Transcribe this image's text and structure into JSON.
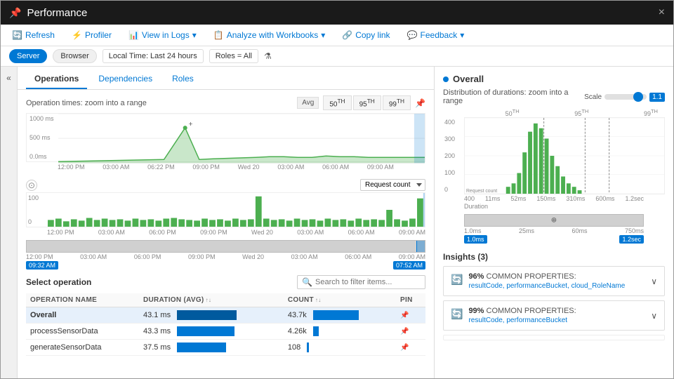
{
  "window": {
    "title": "Performance",
    "close_label": "×",
    "pin_label": "📌"
  },
  "toolbar": {
    "refresh_label": "Refresh",
    "profiler_label": "Profiler",
    "view_in_logs_label": "View in Logs",
    "analyze_label": "Analyze with Workbooks",
    "copy_link_label": "Copy link",
    "feedback_label": "Feedback"
  },
  "filter_bar": {
    "server_label": "Server",
    "browser_label": "Browser",
    "time_label": "Local Time: Last 24 hours",
    "roles_label": "Roles = All"
  },
  "tabs": {
    "operations": "Operations",
    "dependencies": "Dependencies",
    "roles": "Roles"
  },
  "chart": {
    "title": "Operation times: zoom into a range",
    "avg_label": "Avg",
    "p50_label": "50",
    "p50_sup": "TH",
    "p95_label": "95",
    "p95_sup": "TH",
    "p99_label": "99",
    "p99_sup": "TH",
    "y_labels": [
      "1000 ms",
      "500 ms",
      "0.0ms"
    ],
    "x_labels": [
      "12:00 PM",
      "03:00 AM",
      "06:22 PM",
      "09:00 PM",
      "Wed 20",
      "03:00 AM",
      "06:00 AM",
      "09:00 AM"
    ]
  },
  "request_chart": {
    "dropdown_label": "Request count",
    "y_labels": [
      "100",
      "0"
    ],
    "x_labels": [
      "12:00 PM",
      "03:00 AM",
      "06:00 PM",
      "09:00 PM",
      "Wed 20",
      "03:00 AM",
      "06:00 AM",
      "09:00 AM"
    ]
  },
  "timeline": {
    "x_labels": [
      "12:00 PM",
      "03:00 AM",
      "06:00 PM",
      "09:00 PM",
      "Wed 20",
      "03:00 AM",
      "06:00 AM",
      "09:00 AM"
    ],
    "start_time": "09:32 AM",
    "end_time": "07:52 AM"
  },
  "operations": {
    "title": "Select operation",
    "search_placeholder": "Search to filter items...",
    "columns": {
      "name": "OPERATION NAME",
      "duration": "DURATION (AVG)",
      "count": "COUNT",
      "pin": "PIN"
    },
    "rows": [
      {
        "name": "Overall",
        "duration": "43.1 ms",
        "duration_pct": 85,
        "count": "43.7k",
        "count_pct": 100,
        "selected": true
      },
      {
        "name": "processSensorData",
        "duration": "43.3 ms",
        "duration_pct": 82,
        "count": "4.26k",
        "count_pct": 10,
        "selected": false
      },
      {
        "name": "generateSensorData",
        "duration": "37.5 ms",
        "duration_pct": 70,
        "count": "108",
        "count_pct": 3,
        "selected": false
      }
    ]
  },
  "right": {
    "overall_title": "Overall",
    "dist_title": "Distribution of durations: zoom into a range",
    "scale_label": "Scale",
    "percentile_labels": [
      "50TH",
      "95TH",
      "99TH"
    ],
    "dist_x_labels": [
      "400",
      "11ms",
      "52ms",
      "150ms",
      "310ms",
      "600ms",
      "1.2sec"
    ],
    "dist_y_labels": [
      "300",
      "200",
      "100",
      "0"
    ],
    "dist_timeline_labels": [
      "1.0ms",
      "25ms",
      "60ms",
      "750ms"
    ],
    "dist_start": "1.0ms",
    "dist_end": "1.2sec",
    "insights_title": "Insights (3)",
    "insights": [
      {
        "pct": "96%",
        "label": "COMMON PROPERTIES:",
        "props": "resultCode, performanceBucket, cloud_RoleName",
        "expanded": false
      },
      {
        "pct": "99%",
        "label": "COMMON PROPERTIES:",
        "props": "resultCode, performanceBucket",
        "expanded": false
      }
    ]
  }
}
